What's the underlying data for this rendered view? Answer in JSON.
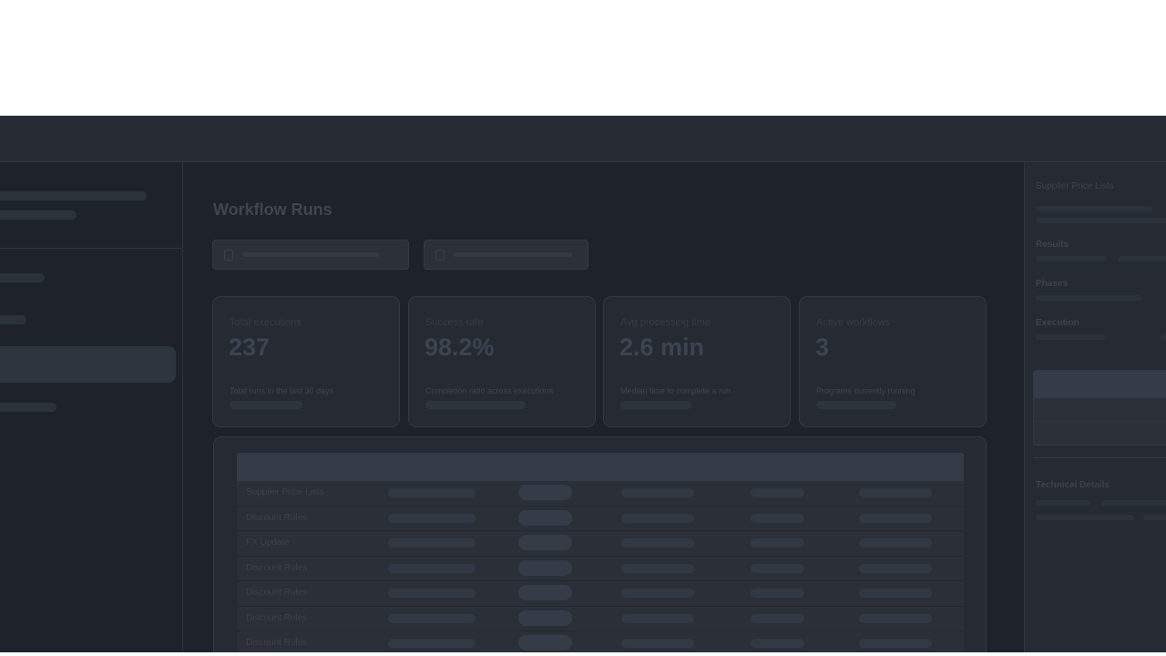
{
  "page": {
    "title": "Workflow Runs"
  },
  "metrics": [
    {
      "label": "Total executions",
      "value": "237",
      "description": "Total runs in the last 30 days"
    },
    {
      "label": "Success rate",
      "value": "98.2%",
      "description": "Completion ratio across executions"
    },
    {
      "label": "Avg processing time",
      "value": "2.6 min",
      "description": "Median time to complete a run"
    },
    {
      "label": "Active workflows",
      "value": "3",
      "description": "Programs currently running"
    }
  ],
  "table": {
    "rows": [
      {
        "name": "Supplier Price Lists"
      },
      {
        "name": "Discount Rules"
      },
      {
        "name": "FX Update"
      },
      {
        "name": "Discount Rules"
      },
      {
        "name": "Discount Rules"
      },
      {
        "name": "Discount Rules"
      },
      {
        "name": "Discount Rules"
      }
    ]
  },
  "detail_panel": {
    "title": "Supplier Price Lists",
    "sections": {
      "results": "Results",
      "phases": "Phases",
      "execution": "Execution",
      "technical": "Technical Details"
    }
  },
  "colors": {
    "app_bg": "#1d222b",
    "overlay_tone": "dimmed"
  }
}
